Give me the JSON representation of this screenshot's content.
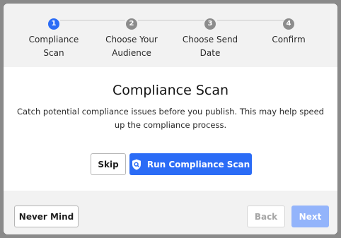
{
  "stepper": {
    "steps": [
      {
        "number": "1",
        "label_line1": "Compliance",
        "label_line2": "Scan"
      },
      {
        "number": "2",
        "label_line1": "Choose Your",
        "label_line2": "Audience"
      },
      {
        "number": "3",
        "label_line1": "Choose Send",
        "label_line2": "Date"
      },
      {
        "number": "4",
        "label_line1": "Confirm",
        "label_line2": ""
      }
    ],
    "active_step": 1
  },
  "main": {
    "title": "Compliance Scan",
    "description": "Catch potential compliance issues before you publish. This may help speed up the compliance process.",
    "skip_label": "Skip",
    "run_scan_label": "Run Compliance Scan",
    "run_scan_icon": "shield-search-icon"
  },
  "footer": {
    "never_mind_label": "Never Mind",
    "back_label": "Back",
    "next_label": "Next"
  },
  "colors": {
    "accent": "#2b6cf6",
    "accent_disabled": "#93b4fb",
    "inactive_step": "#8c8c8c"
  }
}
